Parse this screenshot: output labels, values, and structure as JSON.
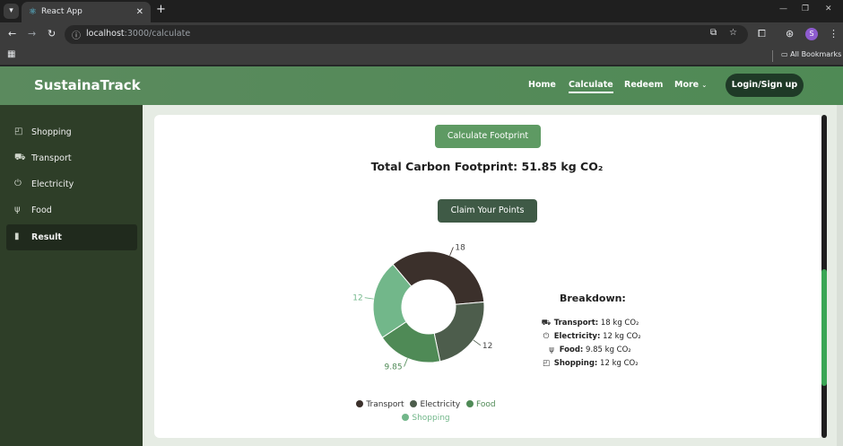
{
  "browser": {
    "tab_title": "React App",
    "url_host": "localhost",
    "url_path": ":3000/calculate",
    "profile_initial": "S",
    "bookmarks_label": "All Bookmarks"
  },
  "header": {
    "brand": "SustainaTrack",
    "nav": [
      {
        "label": "Home"
      },
      {
        "label": "Calculate",
        "active": true
      },
      {
        "label": "Redeem"
      },
      {
        "label": "More"
      }
    ],
    "login_label": "Login/Sign up"
  },
  "sidebar": {
    "items": [
      {
        "label": "Shopping",
        "icon": "bag-icon"
      },
      {
        "label": "Transport",
        "icon": "truck-icon"
      },
      {
        "label": "Electricity",
        "icon": "power-icon"
      },
      {
        "label": "Food",
        "icon": "utensils-icon"
      },
      {
        "label": "Result",
        "icon": "chart-icon",
        "active": true
      }
    ]
  },
  "main": {
    "calc_button": "Calculate Footprint",
    "total_text": "Total Carbon Footprint: 51.85 kg CO₂",
    "claim_button": "Claim Your Points",
    "breakdown_title": "Breakdown:",
    "breakdown": [
      {
        "label": "Transport:",
        "value": "18 kg CO₂"
      },
      {
        "label": "Electricity:",
        "value": "12 kg CO₂"
      },
      {
        "label": "Food:",
        "value": "9.85 kg CO₂"
      },
      {
        "label": "Shopping:",
        "value": "12 kg CO₂"
      }
    ]
  },
  "colors": {
    "brand_green": "#5b8a5e",
    "transport": "#3b302b",
    "electricity": "#4d5d4c",
    "food": "#4f8a56",
    "shopping": "#72b78a"
  },
  "chart_data": {
    "type": "pie",
    "categories": [
      "Transport",
      "Electricity",
      "Food",
      "Shopping"
    ],
    "values": [
      18,
      12,
      9.85,
      12
    ],
    "slice_labels": [
      "18",
      "12",
      "9.85",
      "12"
    ],
    "donut": true,
    "legend": "bottom"
  }
}
